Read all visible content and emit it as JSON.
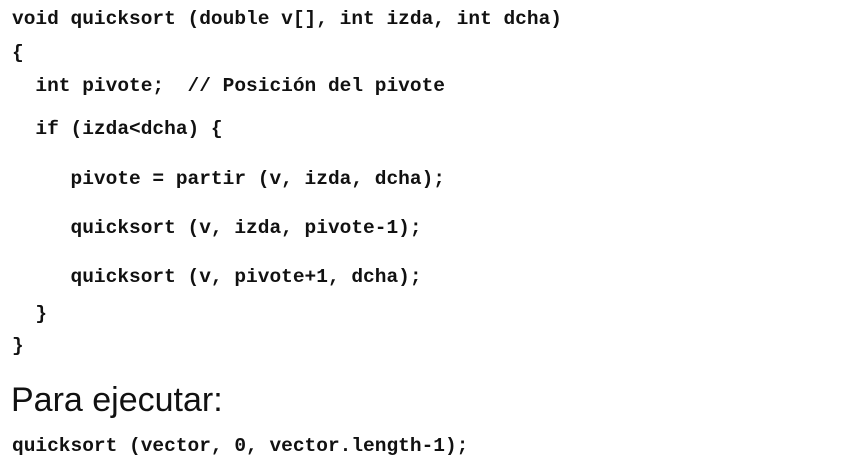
{
  "code_block": {
    "lines": [
      "void quicksort (double v[], int izda, int dcha)",
      "{",
      "  int pivote;  // Posición del pivote",
      "  if (izda<dcha) {",
      "     pivote = partir (v, izda, dcha);",
      "     quicksort (v, izda, pivote-1);",
      "     quicksort (v, pivote+1, dcha);",
      "  }",
      "}"
    ]
  },
  "usage": {
    "heading": "Para ejecutar:",
    "call": "quicksort (vector, 0, vector.length-1);"
  }
}
